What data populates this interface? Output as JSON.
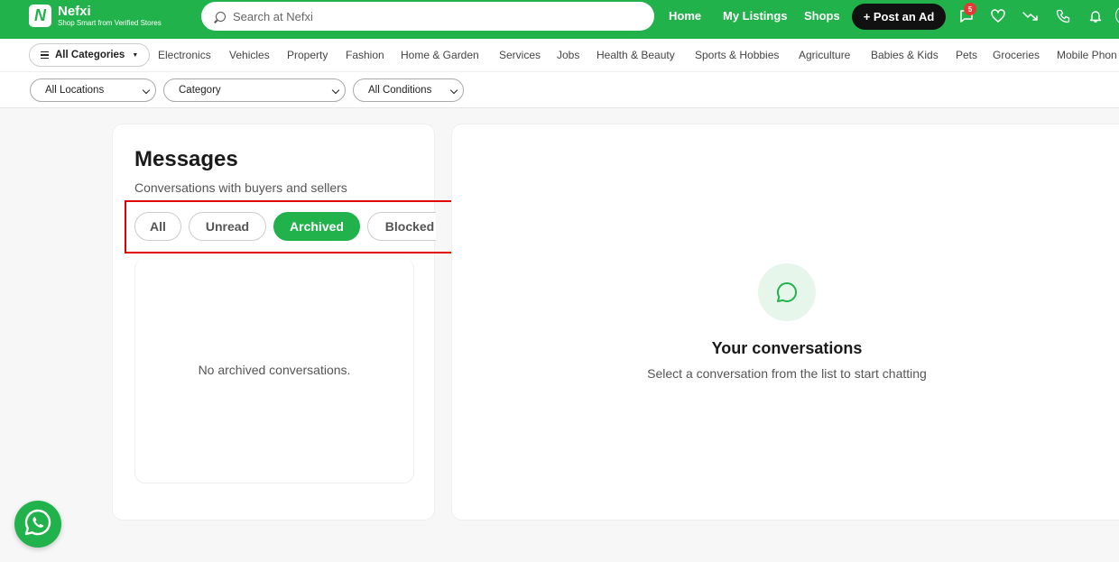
{
  "brand": {
    "name": "Nefxi",
    "tagline": "Shop Smart from Verified Stores",
    "logo_letter": "N",
    "color": "#21b24b"
  },
  "header": {
    "search_placeholder": "Search at Nefxi",
    "nav": {
      "home": "Home",
      "my_listings": "My Listings",
      "shops": "Shops"
    },
    "post_ad": "+ Post an Ad",
    "message_count": "5",
    "icons": [
      "chat-icon",
      "heart-icon",
      "trend-icon",
      "phone-icon",
      "bell-icon"
    ]
  },
  "categories": {
    "all_label": "All Categories",
    "items": [
      "Electronics",
      "Vehicles",
      "Property",
      "Fashion",
      "Home & Garden",
      "Services",
      "Jobs",
      "Health & Beauty",
      "Sports & Hobbies",
      "Agriculture",
      "Babies & Kids",
      "Pets",
      "Groceries",
      "Mobile Phon"
    ]
  },
  "filters": {
    "location": "All Locations",
    "category": "Category",
    "condition": "All Conditions"
  },
  "messages": {
    "title": "Messages",
    "subtitle": "Conversations with buyers and sellers",
    "tabs": [
      "All",
      "Unread",
      "Archived",
      "Blocked"
    ],
    "active_tab": "Archived",
    "empty": "No archived conversations."
  },
  "conversation_pane": {
    "title": "Your conversations",
    "subtitle": "Select a conversation from the list to start chatting"
  }
}
